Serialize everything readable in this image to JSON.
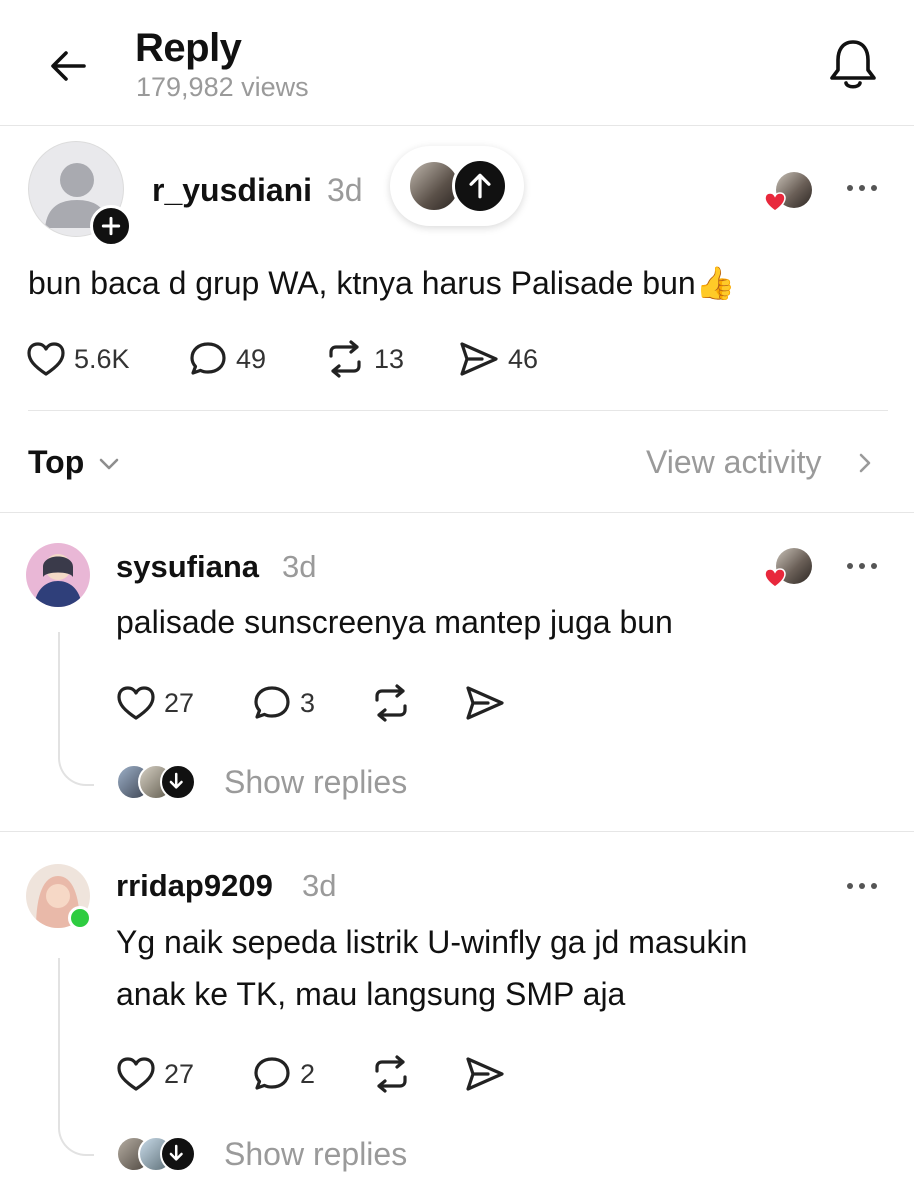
{
  "header": {
    "title": "Reply",
    "views": "179,982 views",
    "back_icon": "arrow-left-icon",
    "bell_icon": "bell-icon"
  },
  "post": {
    "username": "r_yusdiani",
    "time": "3d",
    "text": "bun baca d grup WA, ktnya harus Palisade bun👍",
    "likes": "5.6K",
    "comments": "49",
    "reposts": "13",
    "shares": "46"
  },
  "sort": {
    "label": "Top",
    "view_activity": "View activity"
  },
  "replies": [
    {
      "username": "sysufiana",
      "time": "3d",
      "text_lines": [
        "palisade sunscreenya mantep juga bun"
      ],
      "likes": "27",
      "comments": "3",
      "show_replies": "Show replies"
    },
    {
      "username": "rridap9209",
      "time": "3d",
      "text_lines": [
        "Yg naik sepeda listrik U-winfly ga jd masukin",
        "anak ke TK, mau langsung SMP aja"
      ],
      "likes": "27",
      "comments": "2",
      "show_replies": "Show replies"
    }
  ],
  "colors": {
    "accent": "#111111",
    "muted": "#9a9a9a",
    "heart": "#e8283c",
    "online": "#2ecc40",
    "divider": "#e6e6e6"
  }
}
